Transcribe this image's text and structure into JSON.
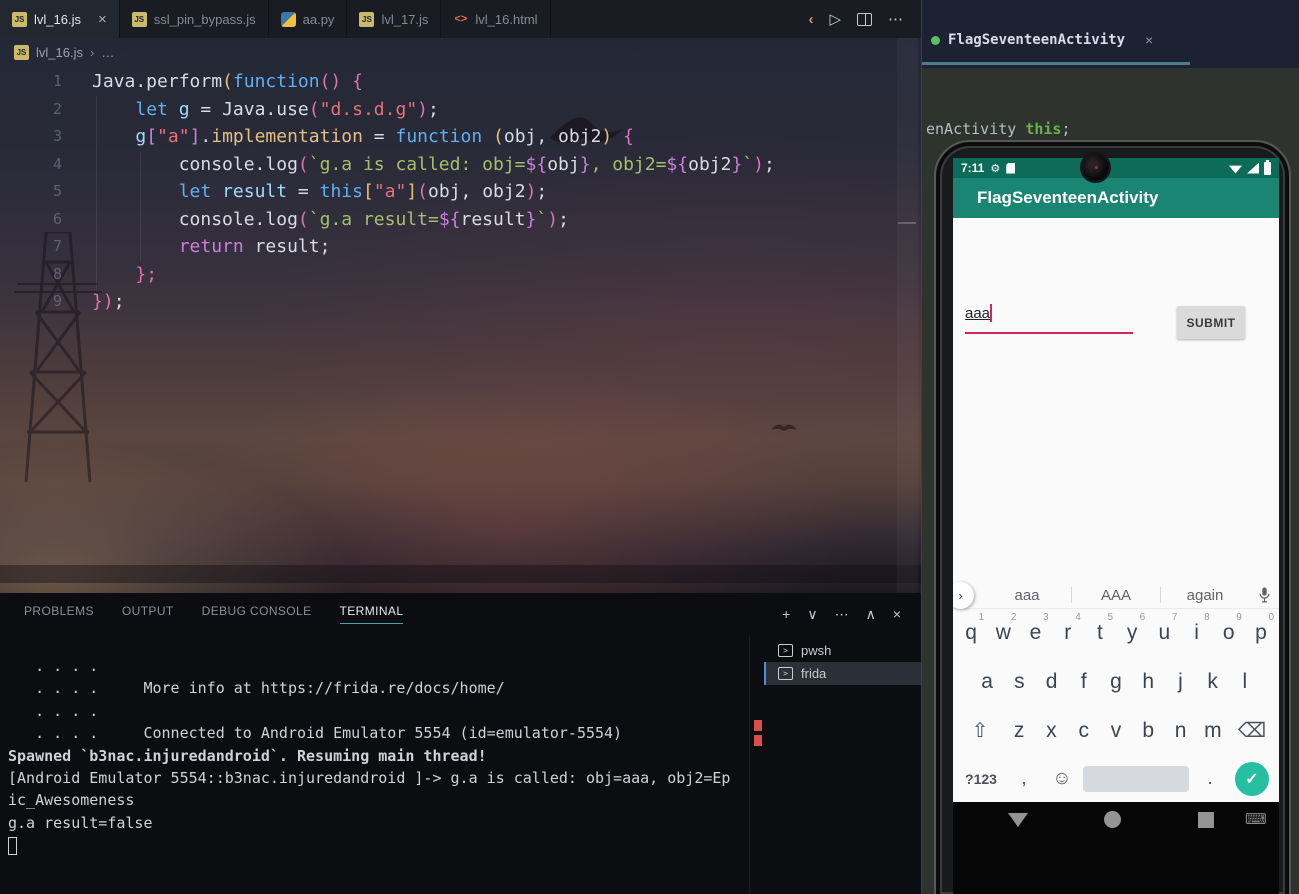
{
  "editor_tabs": [
    {
      "label": "lvl_16.js",
      "icon": "js",
      "active": true,
      "close": "×"
    },
    {
      "label": "ssl_pin_bypass.js",
      "icon": "js",
      "active": false
    },
    {
      "label": "aa.py",
      "icon": "py",
      "active": false
    },
    {
      "label": "lvl_17.js",
      "icon": "js",
      "active": false
    },
    {
      "label": "lvl_16.html",
      "icon": "html",
      "active": false
    }
  ],
  "tab_actions": {
    "back": "‹",
    "run": "▷",
    "more": "⋯"
  },
  "breadcrumb": {
    "file": "lvl_16.js",
    "separator": "›",
    "more": "…"
  },
  "code": {
    "lines": [
      {
        "num": "1",
        "tokens": [
          [
            "wh",
            "Java.perform"
          ],
          [
            "gold",
            "("
          ],
          [
            "blue",
            "function"
          ],
          [
            "pnk",
            "() {"
          ]
        ]
      },
      {
        "num": "2",
        "tokens": [
          [
            "wh",
            "    "
          ],
          [
            "blue",
            "let "
          ],
          [
            "lblue",
            "g"
          ],
          [
            "wh",
            " = "
          ],
          [
            "wh",
            "Java.use"
          ],
          [
            "pnk",
            "("
          ],
          [
            "str",
            "\"d.s.d.g\""
          ],
          [
            "pnk",
            ")"
          ],
          [
            "wh",
            ";"
          ]
        ]
      },
      {
        "num": "3",
        "tokens": [
          [
            "wh",
            "    "
          ],
          [
            "lblue",
            "g"
          ],
          [
            "pur",
            "["
          ],
          [
            "str",
            "\"a\""
          ],
          [
            "pur",
            "]"
          ],
          [
            "wh",
            "."
          ],
          [
            "ylw",
            "implementation"
          ],
          [
            "wh",
            " = "
          ],
          [
            "blue",
            "function "
          ],
          [
            "gold",
            "("
          ],
          [
            "wh",
            "obj, obj2"
          ],
          [
            "gold",
            ")"
          ],
          [
            "pnk",
            " {"
          ]
        ]
      },
      {
        "num": "4",
        "tokens": [
          [
            "wh",
            "        "
          ],
          [
            "wh",
            "console.log"
          ],
          [
            "pnk",
            "("
          ],
          [
            "grn",
            "`g.a is called: obj="
          ],
          [
            "pur",
            "${"
          ],
          [
            "wh",
            "obj"
          ],
          [
            "pur",
            "}"
          ],
          [
            "grn",
            ", obj2="
          ],
          [
            "pur",
            "${"
          ],
          [
            "wh",
            "obj2"
          ],
          [
            "pur",
            "}"
          ],
          [
            "grn",
            "`"
          ],
          [
            "pnk",
            ")"
          ],
          [
            "wh",
            ";"
          ]
        ]
      },
      {
        "num": "5",
        "tokens": [
          [
            "wh",
            "        "
          ],
          [
            "blue",
            "let "
          ],
          [
            "lblue",
            "result"
          ],
          [
            "wh",
            " = "
          ],
          [
            "blue",
            "this"
          ],
          [
            "gold",
            "["
          ],
          [
            "str",
            "\"a\""
          ],
          [
            "gold",
            "]"
          ],
          [
            "pnk",
            "("
          ],
          [
            "wh",
            "obj, obj2"
          ],
          [
            "pnk",
            ")"
          ],
          [
            "wh",
            ";"
          ]
        ]
      },
      {
        "num": "6",
        "tokens": [
          [
            "wh",
            "        "
          ],
          [
            "wh",
            "console.log"
          ],
          [
            "pnk",
            "("
          ],
          [
            "grn",
            "`g.a result="
          ],
          [
            "pur",
            "${"
          ],
          [
            "wh",
            "result"
          ],
          [
            "pur",
            "}"
          ],
          [
            "grn",
            "`"
          ],
          [
            "pnk",
            ")"
          ],
          [
            "wh",
            ";"
          ]
        ]
      },
      {
        "num": "7",
        "tokens": [
          [
            "wh",
            "        "
          ],
          [
            "pur",
            "return "
          ],
          [
            "wh",
            "result;"
          ]
        ]
      },
      {
        "num": "8",
        "tokens": [
          [
            "wh",
            "    "
          ],
          [
            "pnk",
            "};"
          ]
        ]
      },
      {
        "num": "9",
        "tokens": [
          [
            "pnk",
            "})"
          ],
          [
            "wh",
            ";"
          ]
        ]
      }
    ]
  },
  "panel": {
    "tabs": [
      {
        "label": "PROBLEMS",
        "active": false
      },
      {
        "label": "OUTPUT",
        "active": false
      },
      {
        "label": "DEBUG CONSOLE",
        "active": false
      },
      {
        "label": "TERMINAL",
        "active": true
      }
    ],
    "actions": [
      {
        "glyph": "+",
        "name": "new-terminal-button"
      },
      {
        "glyph": "∨",
        "name": "terminal-profile-dropdown"
      },
      {
        "glyph": "⋯",
        "name": "panel-more-actions"
      },
      {
        "glyph": "∧",
        "name": "maximize-panel-button"
      },
      {
        "glyph": "×",
        "name": "close-panel-button"
      }
    ]
  },
  "terminal": {
    "lines": [
      {
        "text": "   . . . .",
        "bold": false
      },
      {
        "text": "   . . . .     More info at https://frida.re/docs/home/",
        "bold": false
      },
      {
        "text": "   . . . .",
        "bold": false
      },
      {
        "text": "   . . . .     Connected to Android Emulator 5554 (id=emulator-5554)",
        "bold": false
      },
      {
        "text": "Spawned `b3nac.injuredandroid`. Resuming main thread!",
        "bold": true
      },
      {
        "text": "[Android Emulator 5554::b3nac.injuredandroid ]-> g.a is called: obj=aaa, obj2=Ep",
        "bold": false
      },
      {
        "text": "ic_Awesomeness",
        "bold": false
      },
      {
        "text": "g.a result=false",
        "bold": false
      }
    ],
    "sessions": [
      {
        "name": "pwsh",
        "selected": false
      },
      {
        "name": "frida",
        "selected": true
      }
    ]
  },
  "decompiler": {
    "tab_label": "FlagSeventeenActivity",
    "close": "×",
    "code_fragment": [
      [
        "plain",
        "enActivity "
      ],
      [
        "kw",
        "this"
      ],
      [
        "plain",
        ";"
      ]
    ]
  },
  "phone": {
    "status": {
      "time": "7:11",
      "gear": "⚙"
    },
    "app_title": "FlagSeventeenActivity",
    "input_value": "aaa",
    "submit_label": "SUBMIT",
    "suggestions": [
      "aaa",
      "AAA",
      "again"
    ],
    "sugg_chevron": "›",
    "keyboard": {
      "row1": [
        [
          "q",
          "1"
        ],
        [
          "w",
          "2"
        ],
        [
          "e",
          "3"
        ],
        [
          "r",
          "4"
        ],
        [
          "t",
          "5"
        ],
        [
          "y",
          "6"
        ],
        [
          "u",
          "7"
        ],
        [
          "i",
          "8"
        ],
        [
          "o",
          "9"
        ],
        [
          "p",
          "0"
        ]
      ],
      "row2": [
        "a",
        "s",
        "d",
        "f",
        "g",
        "h",
        "j",
        "k",
        "l"
      ],
      "row3": [
        "z",
        "x",
        "c",
        "v",
        "b",
        "n",
        "m"
      ],
      "shift": "⇧",
      "backspace": "⌫",
      "symbols": "?123",
      "comma": ",",
      "emoji": "☺",
      "period": ".",
      "check": "✓",
      "kbd_nav": "⌨"
    }
  },
  "colors": {
    "appbar_teal": "#1b8573",
    "statusbar_teal": "#0c6b59",
    "field_pink": "#d5245f",
    "check_teal": "#27bfa2",
    "panel_tab_underline": "#519aba",
    "session_selected_blue": "#4f8bd6",
    "jadx_underline_teal": "#4c7d8b"
  }
}
